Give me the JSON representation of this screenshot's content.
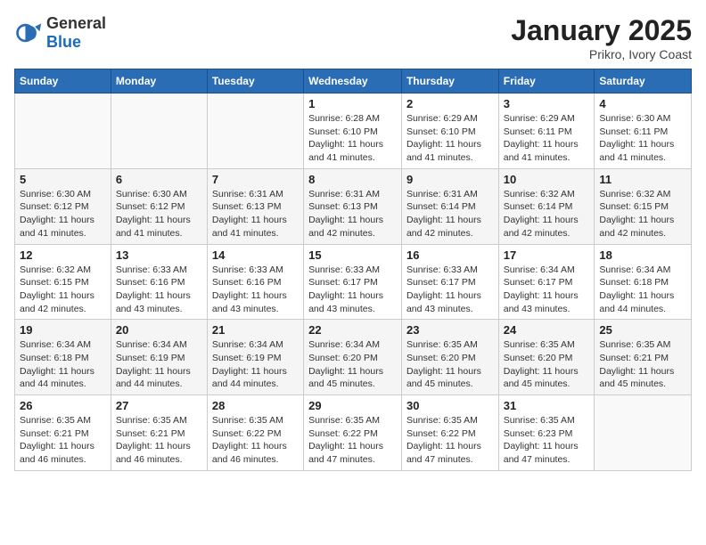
{
  "header": {
    "logo_general": "General",
    "logo_blue": "Blue",
    "month_title": "January 2025",
    "subtitle": "Prikro, Ivory Coast"
  },
  "weekdays": [
    "Sunday",
    "Monday",
    "Tuesday",
    "Wednesday",
    "Thursday",
    "Friday",
    "Saturday"
  ],
  "weeks": [
    [
      {
        "day": "",
        "info": ""
      },
      {
        "day": "",
        "info": ""
      },
      {
        "day": "",
        "info": ""
      },
      {
        "day": "1",
        "info": "Sunrise: 6:28 AM\nSunset: 6:10 PM\nDaylight: 11 hours and 41 minutes."
      },
      {
        "day": "2",
        "info": "Sunrise: 6:29 AM\nSunset: 6:10 PM\nDaylight: 11 hours and 41 minutes."
      },
      {
        "day": "3",
        "info": "Sunrise: 6:29 AM\nSunset: 6:11 PM\nDaylight: 11 hours and 41 minutes."
      },
      {
        "day": "4",
        "info": "Sunrise: 6:30 AM\nSunset: 6:11 PM\nDaylight: 11 hours and 41 minutes."
      }
    ],
    [
      {
        "day": "5",
        "info": "Sunrise: 6:30 AM\nSunset: 6:12 PM\nDaylight: 11 hours and 41 minutes."
      },
      {
        "day": "6",
        "info": "Sunrise: 6:30 AM\nSunset: 6:12 PM\nDaylight: 11 hours and 41 minutes."
      },
      {
        "day": "7",
        "info": "Sunrise: 6:31 AM\nSunset: 6:13 PM\nDaylight: 11 hours and 41 minutes."
      },
      {
        "day": "8",
        "info": "Sunrise: 6:31 AM\nSunset: 6:13 PM\nDaylight: 11 hours and 42 minutes."
      },
      {
        "day": "9",
        "info": "Sunrise: 6:31 AM\nSunset: 6:14 PM\nDaylight: 11 hours and 42 minutes."
      },
      {
        "day": "10",
        "info": "Sunrise: 6:32 AM\nSunset: 6:14 PM\nDaylight: 11 hours and 42 minutes."
      },
      {
        "day": "11",
        "info": "Sunrise: 6:32 AM\nSunset: 6:15 PM\nDaylight: 11 hours and 42 minutes."
      }
    ],
    [
      {
        "day": "12",
        "info": "Sunrise: 6:32 AM\nSunset: 6:15 PM\nDaylight: 11 hours and 42 minutes."
      },
      {
        "day": "13",
        "info": "Sunrise: 6:33 AM\nSunset: 6:16 PM\nDaylight: 11 hours and 43 minutes."
      },
      {
        "day": "14",
        "info": "Sunrise: 6:33 AM\nSunset: 6:16 PM\nDaylight: 11 hours and 43 minutes."
      },
      {
        "day": "15",
        "info": "Sunrise: 6:33 AM\nSunset: 6:17 PM\nDaylight: 11 hours and 43 minutes."
      },
      {
        "day": "16",
        "info": "Sunrise: 6:33 AM\nSunset: 6:17 PM\nDaylight: 11 hours and 43 minutes."
      },
      {
        "day": "17",
        "info": "Sunrise: 6:34 AM\nSunset: 6:17 PM\nDaylight: 11 hours and 43 minutes."
      },
      {
        "day": "18",
        "info": "Sunrise: 6:34 AM\nSunset: 6:18 PM\nDaylight: 11 hours and 44 minutes."
      }
    ],
    [
      {
        "day": "19",
        "info": "Sunrise: 6:34 AM\nSunset: 6:18 PM\nDaylight: 11 hours and 44 minutes."
      },
      {
        "day": "20",
        "info": "Sunrise: 6:34 AM\nSunset: 6:19 PM\nDaylight: 11 hours and 44 minutes."
      },
      {
        "day": "21",
        "info": "Sunrise: 6:34 AM\nSunset: 6:19 PM\nDaylight: 11 hours and 44 minutes."
      },
      {
        "day": "22",
        "info": "Sunrise: 6:34 AM\nSunset: 6:20 PM\nDaylight: 11 hours and 45 minutes."
      },
      {
        "day": "23",
        "info": "Sunrise: 6:35 AM\nSunset: 6:20 PM\nDaylight: 11 hours and 45 minutes."
      },
      {
        "day": "24",
        "info": "Sunrise: 6:35 AM\nSunset: 6:20 PM\nDaylight: 11 hours and 45 minutes."
      },
      {
        "day": "25",
        "info": "Sunrise: 6:35 AM\nSunset: 6:21 PM\nDaylight: 11 hours and 45 minutes."
      }
    ],
    [
      {
        "day": "26",
        "info": "Sunrise: 6:35 AM\nSunset: 6:21 PM\nDaylight: 11 hours and 46 minutes."
      },
      {
        "day": "27",
        "info": "Sunrise: 6:35 AM\nSunset: 6:21 PM\nDaylight: 11 hours and 46 minutes."
      },
      {
        "day": "28",
        "info": "Sunrise: 6:35 AM\nSunset: 6:22 PM\nDaylight: 11 hours and 46 minutes."
      },
      {
        "day": "29",
        "info": "Sunrise: 6:35 AM\nSunset: 6:22 PM\nDaylight: 11 hours and 47 minutes."
      },
      {
        "day": "30",
        "info": "Sunrise: 6:35 AM\nSunset: 6:22 PM\nDaylight: 11 hours and 47 minutes."
      },
      {
        "day": "31",
        "info": "Sunrise: 6:35 AM\nSunset: 6:23 PM\nDaylight: 11 hours and 47 minutes."
      },
      {
        "day": "",
        "info": ""
      }
    ]
  ]
}
